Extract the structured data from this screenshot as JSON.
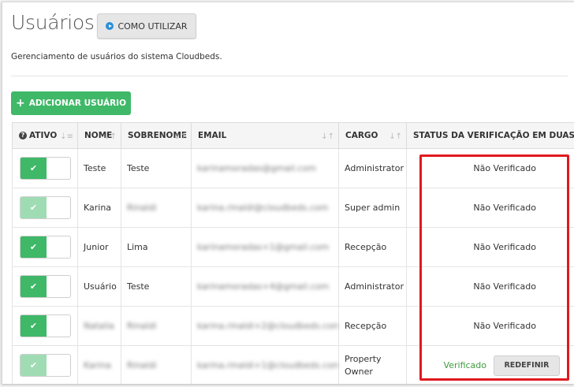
{
  "header": {
    "title": "Usuários",
    "how_to_label": "COMO UTILIZAR",
    "subtitle": "Gerenciamento de usuários do sistema Cloudbeds."
  },
  "add_button_label": "ADICIONAR USUÁRIO",
  "table": {
    "columns": {
      "ativo": "ATIVO",
      "nome": "NOME",
      "sobrenome": "SOBRENOME",
      "email": "EMAIL",
      "cargo": "CARGO",
      "status": "STATUS DA VERIFICAÇÃO EM DUAS ETA"
    },
    "reset_label": "REDEFINIR",
    "rows": [
      {
        "nome": "Teste",
        "sobrenome": "Teste",
        "email": "karinamoradas@gmail.com",
        "cargo": "Administrator",
        "status": "Não Verificado"
      },
      {
        "nome": "Karina",
        "sobrenome": "Rinaldi",
        "email": "karina.rinaldi@cloudbeds.com",
        "cargo": "Super admin",
        "status": "Não Verificado"
      },
      {
        "nome": "Junior",
        "sobrenome": "Lima",
        "email": "karinamoradas+1@gmail.com",
        "cargo": "Recepção",
        "status": "Não Verificado"
      },
      {
        "nome": "Usuário",
        "sobrenome": "Teste",
        "email": "karinamoradas+4@gmail.com",
        "cargo": "Administrator",
        "status": "Não Verificado"
      },
      {
        "nome": "Natalia",
        "sobrenome": "Rinaldi",
        "email": "karina.rinaldi+2@cloudbeds.com",
        "cargo": "Recepção",
        "status": "Não Verificado"
      },
      {
        "nome": "Karina",
        "sobrenome": "Rinaldi",
        "email": "karina.rinaldi+1@cloudbeds.com",
        "cargo": "Property Owner",
        "status": "Verificado"
      }
    ]
  },
  "colors": {
    "accent_green": "#3fb868",
    "highlight_red": "#e0191e",
    "verified_green": "#3e9b3e"
  }
}
